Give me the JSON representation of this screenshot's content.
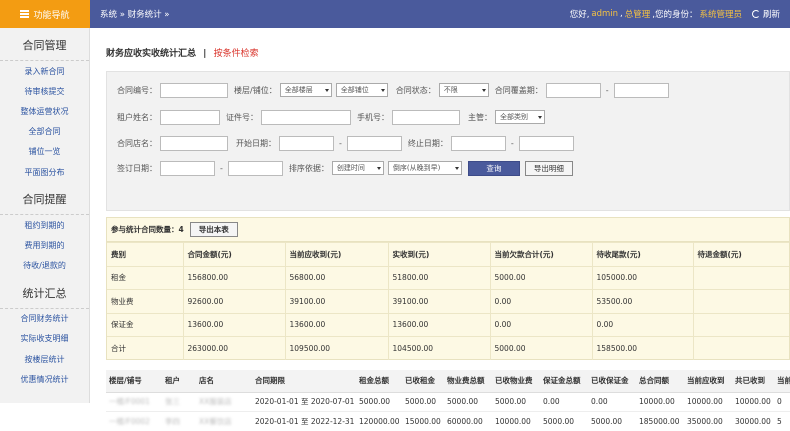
{
  "topbar": {
    "nav_label": "功能导航",
    "breadcrumb": "系统 » 财务统计 »",
    "greeting_prefix": "您好,",
    "username": "admin",
    "separator": ",",
    "role_label": "总管理",
    "identity_prefix": ",您的身份：",
    "identity": "系统管理员",
    "refresh_label": "刷新"
  },
  "sidebar": {
    "groups": [
      {
        "title": "合同管理",
        "items": [
          "录入新合同",
          "待审核提交",
          "整体运营状况",
          "全部合同",
          "铺位一览",
          "平面图分布"
        ]
      },
      {
        "title": "合同提醒",
        "items": [
          "租约到期的",
          "费用到期的",
          "待收/退款的"
        ]
      },
      {
        "title": "统计汇总",
        "items": [
          "合同财务统计",
          "实际收支明细",
          "按楼层统计",
          "优惠情况统计"
        ]
      }
    ]
  },
  "page": {
    "title": "财务应收实收统计汇总",
    "separator": "|",
    "search_link": "按条件检索"
  },
  "filter": {
    "contract_no": "合同编号：",
    "floor": "楼层/铺位：",
    "floor_select": "全部楼层",
    "shop_select": "全部铺位",
    "status": "合同状态：",
    "status_select": "不限",
    "coverage": "合同覆盖期：",
    "tenant": "租户姓名：",
    "id_no": "证件号：",
    "phone": "手机号：",
    "manager": "主管：",
    "manager_select": "全部类别",
    "shop_name": "合同店名：",
    "start_date": "开始日期：",
    "end_date": "终止日期：",
    "sign_date": "签订日期：",
    "sort_by": "排序依据：",
    "sort_select": "创建时间",
    "order_select": "倒序(从晚到早)",
    "dash": "-",
    "query_btn": "查询",
    "export_detail_btn": "导出明细"
  },
  "summary": {
    "count_label": "参与统计合同数量：4",
    "export_btn": "导出本表",
    "headers": [
      "费别",
      "合同金额(元)",
      "当前应收到(元)",
      "实收到(元)",
      "当前欠款合计(元)",
      "待收尾款(元)",
      "待退金额(元)"
    ],
    "rows": [
      [
        "租金",
        "156800.00",
        "56800.00",
        "51800.00",
        "5000.00",
        "105000.00",
        "0.00"
      ],
      [
        "物业费",
        "92600.00",
        "39100.00",
        "39100.00",
        "0.00",
        "53500.00",
        "0.00"
      ],
      [
        "保证金",
        "13600.00",
        "13600.00",
        "13600.00",
        "0.00",
        "0.00",
        "0.00"
      ],
      [
        "合计",
        "263000.00",
        "109500.00",
        "104500.00",
        "5000.00",
        "158500.00",
        "0.00"
      ]
    ]
  },
  "detail": {
    "headers": [
      "楼层/铺号",
      "租户",
      "店名",
      "合同期限",
      "租金总额",
      "已收租金",
      "物业费总额",
      "已收物业费",
      "保证金总额",
      "已收保证金",
      "总合同额",
      "当前应收到",
      "共已收到",
      "当前"
    ],
    "rows": [
      [
        "一楼/F0001",
        "张三",
        "XX服装店",
        "2020-01-01 至 2020-07-01",
        "5000.00",
        "5000.00",
        "5000.00",
        "5000.00",
        "0.00",
        "0.00",
        "10000.00",
        "10000.00",
        "10000.00",
        "0"
      ],
      [
        "一楼/F0002",
        "李四",
        "XX餐饮店",
        "2020-01-01 至 2022-12-31",
        "120000.00",
        "15000.00",
        "60000.00",
        "10000.00",
        "5000.00",
        "5000.00",
        "185000.00",
        "35000.00",
        "30000.00",
        "5"
      ]
    ]
  }
}
